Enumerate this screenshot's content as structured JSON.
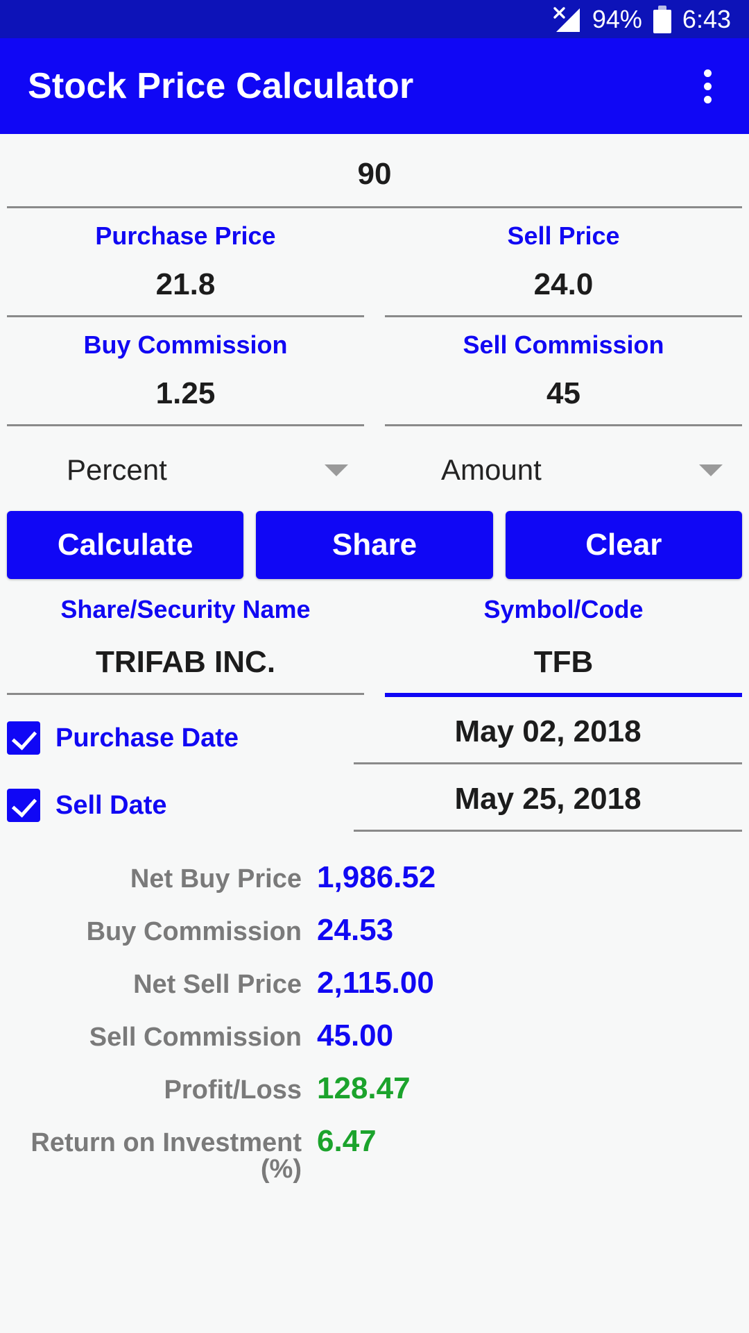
{
  "status_bar": {
    "signal_icon": "signal-no-sim-icon",
    "battery_percent": "94%",
    "battery_icon": "battery-icon",
    "time": "6:43"
  },
  "app_bar": {
    "title": "Stock Price Calculator",
    "overflow_icon": "overflow-menu-icon"
  },
  "form": {
    "quantity": {
      "value": "90"
    },
    "purchase_price": {
      "label": "Purchase Price",
      "value": "21.8"
    },
    "sell_price": {
      "label": "Sell Price",
      "value": "24.0"
    },
    "buy_commission": {
      "label": "Buy Commission",
      "value": "1.25"
    },
    "sell_commission": {
      "label": "Sell Commission",
      "value": "45"
    },
    "buy_commission_type": {
      "value": "Percent"
    },
    "sell_commission_type": {
      "value": "Amount"
    },
    "share_name": {
      "label": "Share/Security Name",
      "value": "TRIFAB INC."
    },
    "symbol": {
      "label": "Symbol/Code",
      "value": "TFB"
    },
    "purchase_date": {
      "label": "Purchase Date",
      "value": "May 02, 2018",
      "checked": true
    },
    "sell_date": {
      "label": "Sell Date",
      "value": "May 25, 2018",
      "checked": true
    }
  },
  "buttons": {
    "calculate": "Calculate",
    "share": "Share",
    "clear": "Clear"
  },
  "results": [
    {
      "label": "Net Buy Price",
      "value": "1,986.52",
      "color": "blue"
    },
    {
      "label": "Buy Commission",
      "value": "24.53",
      "color": "blue"
    },
    {
      "label": "Net Sell Price",
      "value": "2,115.00",
      "color": "blue"
    },
    {
      "label": "Sell Commission",
      "value": "45.00",
      "color": "blue"
    },
    {
      "label": "Profit/Loss",
      "value": "128.47",
      "color": "green"
    },
    {
      "label": "Return on Investment (%)",
      "value": "6.47",
      "color": "green"
    }
  ],
  "colors": {
    "accent_blue": "#1007f5",
    "status_bar_blue": "#0d13b8",
    "label_blue": "#1108f3",
    "value_green": "#1ba32c",
    "result_label_gray": "#7a7a7a",
    "background": "#f7f8f8"
  }
}
